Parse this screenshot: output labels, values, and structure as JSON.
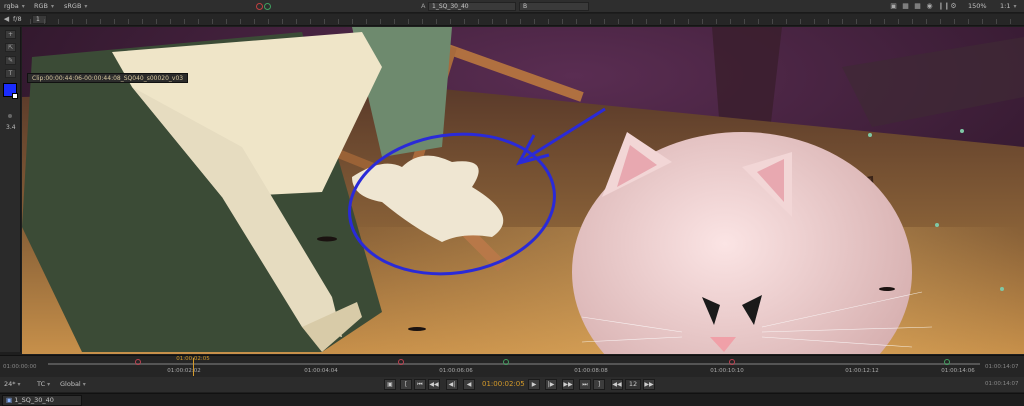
{
  "toolbar": {
    "channels": "rgba",
    "colorspace": "RGB",
    "display_lut": "sRGB",
    "input_a": "1_SQ_30_40",
    "input_b": "B",
    "zoom": "150%",
    "ratio": "1:1"
  },
  "bar2": {
    "fstop": "f/8",
    "frame_field": "1"
  },
  "left_tools": {
    "value_label": "3.4",
    "brush_color": "#1a2cff"
  },
  "viewer": {
    "clip_info": "Clip:00:00:44:06-00:00:44:08_SQ040_s00020_v03",
    "annotation_color": "#2a2ad8"
  },
  "timeline": {
    "start_tc": "01:00:00:00",
    "end_tc": "01:00:14:07",
    "playhead_tc": "01:00:02:05",
    "labels": [
      "01:00:02:02",
      "01:00:04:04",
      "01:00:06:06",
      "01:00:08:08",
      "01:00:10:10",
      "01:00:12:12",
      "01:00:14:06"
    ]
  },
  "transport": {
    "fps": "24*",
    "time_format": "TC",
    "scope": "Global",
    "current_tc": "01:00:02:05",
    "step": "12",
    "frame_count": "01:00:14:07"
  },
  "tabs": {
    "active": "1_SQ_30_40"
  }
}
